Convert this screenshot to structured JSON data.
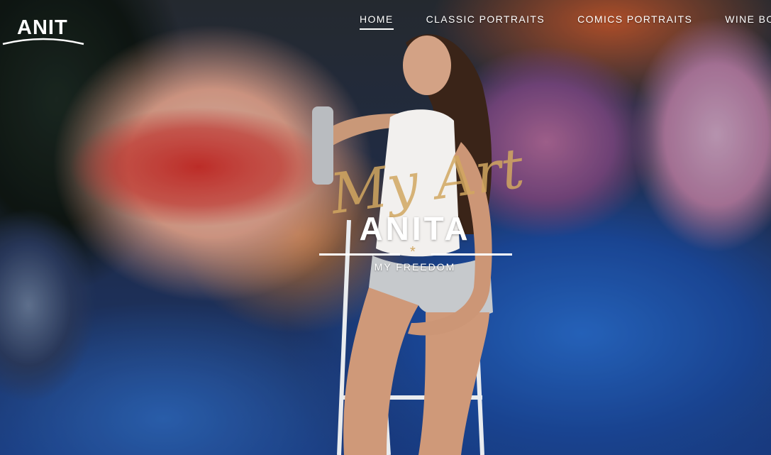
{
  "brand": {
    "logo_text": "ANIT"
  },
  "nav": {
    "items": [
      {
        "label": "HOME",
        "active": true
      },
      {
        "label": "CLASSIC PORTRAITS",
        "active": false
      },
      {
        "label": "COMICS PORTRAITS",
        "active": false
      },
      {
        "label": "WINE BOXES",
        "active": false
      }
    ]
  },
  "hero": {
    "script_text": "My Art",
    "title": "ANITA",
    "ornament": "*",
    "subtitle": "MY FREEDOM",
    "script_color": "#d1a760"
  }
}
